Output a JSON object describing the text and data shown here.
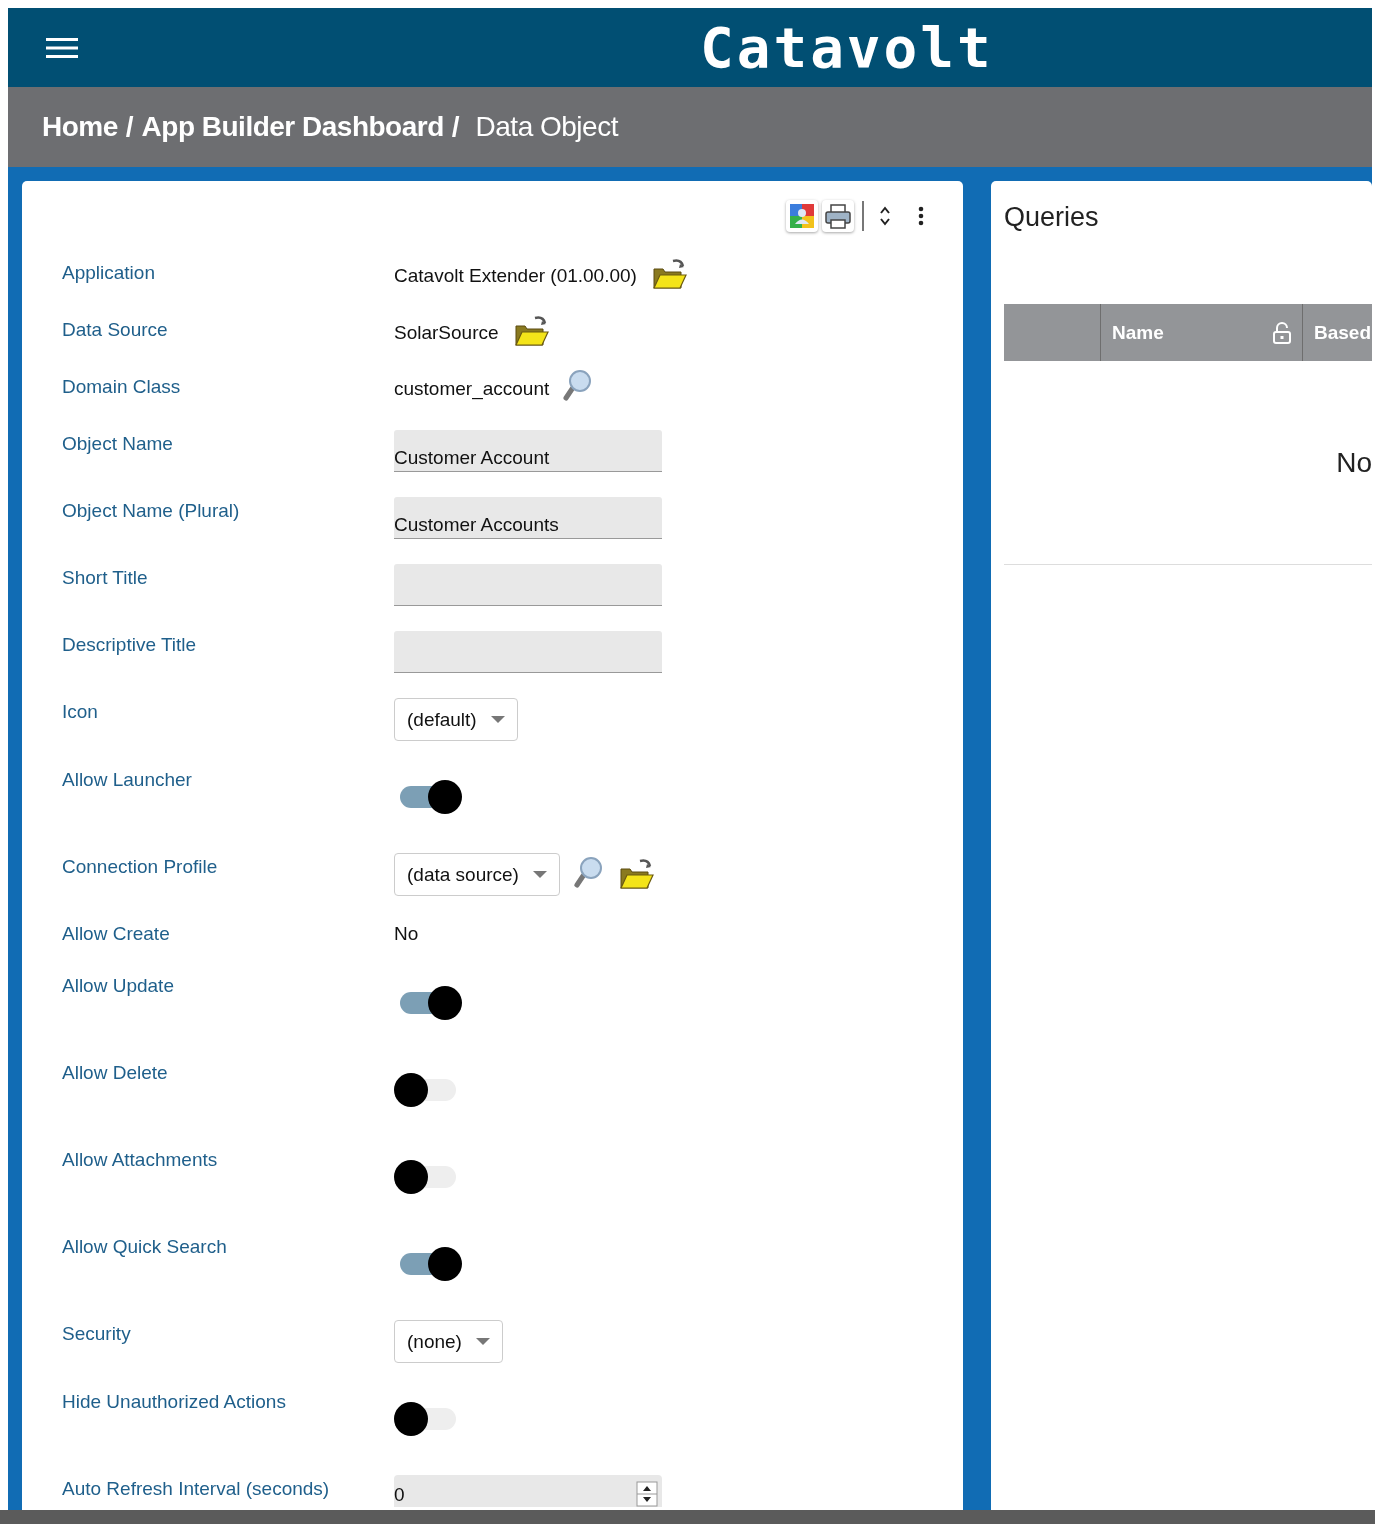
{
  "header": {
    "logo": "Catavolt"
  },
  "breadcrumb": {
    "separator": "/",
    "items": [
      {
        "label": "Home",
        "current": false
      },
      {
        "label": "App Builder Dashboard",
        "current": false
      },
      {
        "label": "Data Object",
        "current": true
      }
    ]
  },
  "form": {
    "fields": [
      {
        "label": "Application",
        "kind": "reference",
        "value": "Catavolt Extender (01.00.00)"
      },
      {
        "label": "Data Source",
        "kind": "reference",
        "value": "SolarSource"
      },
      {
        "label": "Domain Class",
        "kind": "lookup",
        "value": "customer_account"
      },
      {
        "label": "Object Name",
        "kind": "field",
        "value": "Customer Account"
      },
      {
        "label": "Object Name (Plural)",
        "kind": "field",
        "value": "Customer Accounts"
      },
      {
        "label": "Short Title",
        "kind": "field"
      },
      {
        "label": "Descriptive Title",
        "kind": "field"
      },
      {
        "label": "Icon",
        "kind": "select",
        "value": "(default)"
      },
      {
        "label": "Allow Launcher",
        "kind": "toggle",
        "on": true
      },
      {
        "label": "Connection Profile",
        "kind": "select-lookup",
        "value": "(data source)"
      },
      {
        "label": "Allow Create",
        "kind": "text",
        "value": "No"
      },
      {
        "label": "Allow Update",
        "kind": "toggle",
        "on": true
      },
      {
        "label": "Allow Delete",
        "kind": "toggle",
        "on": false
      },
      {
        "label": "Allow Attachments",
        "kind": "toggle",
        "on": false
      },
      {
        "label": "Allow Quick Search",
        "kind": "toggle",
        "on": true
      },
      {
        "label": "Security",
        "kind": "select",
        "value": "(none)"
      },
      {
        "label": "Hide Unauthorized Actions",
        "kind": "toggle",
        "on": false
      },
      {
        "label": "Auto Refresh Interval (seconds)",
        "kind": "number",
        "value": "0"
      }
    ]
  },
  "queries": {
    "title": "Queries",
    "columns": [
      {
        "label": "Name",
        "kind": "lockable"
      },
      {
        "label": "Based",
        "kind": "plain"
      }
    ],
    "empty_message": "No"
  }
}
